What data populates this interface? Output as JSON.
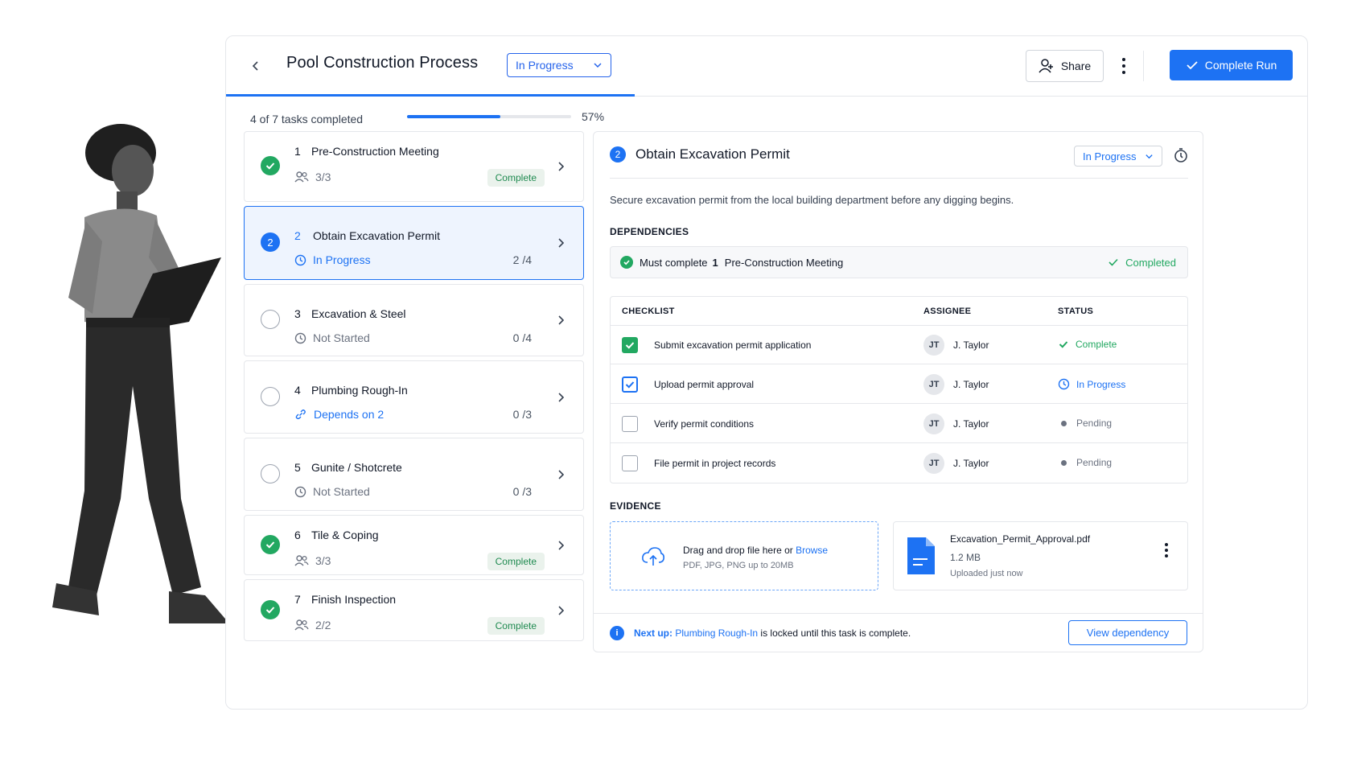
{
  "header": {
    "title": "Pool Construction Process",
    "status": "In Progress",
    "share_label": "Share",
    "complete_run_label": "Complete Run"
  },
  "progress": {
    "text": "4 of 7 tasks completed",
    "percent_label": "57%",
    "fraction": 0.57
  },
  "tasks": [
    {
      "num": "1",
      "name": "Pre-Construction Meeting",
      "state": "done",
      "sub": "3/3",
      "badge": "Complete"
    },
    {
      "num": "2",
      "name": "Obtain Excavation Permit",
      "state": "current",
      "sub": "In Progress",
      "count": "2 /4"
    },
    {
      "num": "3",
      "name": "Excavation & Steel",
      "state": "todo",
      "sub": "Not Started",
      "count": "0 /4"
    },
    {
      "num": "4",
      "name": "Plumbing Rough-In",
      "state": "todo",
      "sub": "Depends on 2",
      "count": "0 /3"
    },
    {
      "num": "5",
      "name": "Gunite / Shotcrete",
      "state": "todo",
      "sub": "Not Started",
      "count": "0 /3"
    },
    {
      "num": "6",
      "name": "Tile & Coping",
      "state": "done",
      "sub": "3/3",
      "badge": "Complete"
    },
    {
      "num": "7",
      "name": "Finish Inspection",
      "state": "done",
      "sub": "2/2",
      "badge": "Complete"
    }
  ],
  "detail": {
    "num": "2",
    "title": "Obtain Excavation Permit",
    "status": "In Progress",
    "description": "Secure excavation permit from the local building department before any digging begins.",
    "dependencies_label": "DEPENDENCIES",
    "dependency": {
      "prefix": "Must complete",
      "num": "1",
      "name": "Pre-Construction Meeting",
      "status": "Completed"
    },
    "checklist": {
      "col_checklist": "CHECKLIST",
      "col_assignee": "ASSIGNEE",
      "col_status": "STATUS",
      "rows": [
        {
          "task": "Submit excavation permit application",
          "initials": "JT",
          "assignee": "J. Taylor",
          "status": "Complete",
          "state": "done"
        },
        {
          "task": "Upload permit approval",
          "initials": "JT",
          "assignee": "J. Taylor",
          "status": "In Progress",
          "state": "prog"
        },
        {
          "task": "Verify permit conditions",
          "initials": "JT",
          "assignee": "J. Taylor",
          "status": "Pending",
          "state": "pend"
        },
        {
          "task": "File permit in project records",
          "initials": "JT",
          "assignee": "J. Taylor",
          "status": "Pending",
          "state": "pend"
        }
      ]
    },
    "evidence_label": "EVIDENCE",
    "dropzone": {
      "text": "Drag and drop file here or",
      "browse": "Browse",
      "hint": "PDF, JPG, PNG up to 20MB"
    },
    "file": {
      "name": "Excavation_Permit_Approval.pdf",
      "size": "1.2 MB",
      "time": "Uploaded just now"
    },
    "footer": {
      "next_up": "Next up:",
      "next_task": "Plumbing Rough-In",
      "suffix": "is locked until this task is complete.",
      "button": "View dependency"
    }
  },
  "colors": {
    "accent": "#1d72f3",
    "success": "#22a861",
    "muted": "#6b7280"
  }
}
